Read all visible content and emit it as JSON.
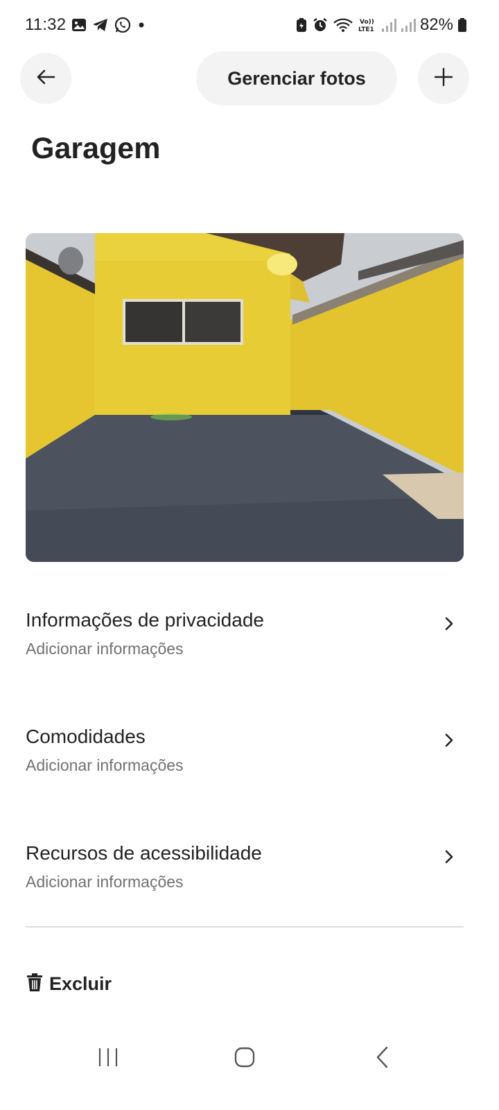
{
  "status_bar": {
    "time": "11:32",
    "battery": "82%",
    "left_icons": [
      "gallery-icon",
      "telegram-icon",
      "whatsapp-icon",
      "dot-icon"
    ],
    "right_icons": [
      "battery-saver-icon",
      "alarm-icon",
      "wifi-icon",
      "volte-icon",
      "signal-icon",
      "signal-icon",
      "battery-icon"
    ]
  },
  "header": {
    "back_icon": "arrow-left-icon",
    "manage_label": "Gerenciar fotos",
    "add_icon": "plus-icon"
  },
  "page": {
    "title": "Garagem"
  },
  "photo": {
    "subject": "garage"
  },
  "sections": [
    {
      "title": "Informações de privacidade",
      "subtitle": "Adicionar informações"
    },
    {
      "title": "Comodidades",
      "subtitle": "Adicionar informações"
    },
    {
      "title": "Recursos de acessibilidade",
      "subtitle": "Adicionar informações"
    }
  ],
  "delete": {
    "label": "Excluir",
    "icon": "trash-icon"
  },
  "nav_bar": {
    "items": [
      "recents-icon",
      "home-icon",
      "back-icon"
    ]
  },
  "colors": {
    "text": "#222222",
    "secondary_text": "#717171",
    "button_bg": "#f3f3f3",
    "divider": "#dddddd"
  }
}
